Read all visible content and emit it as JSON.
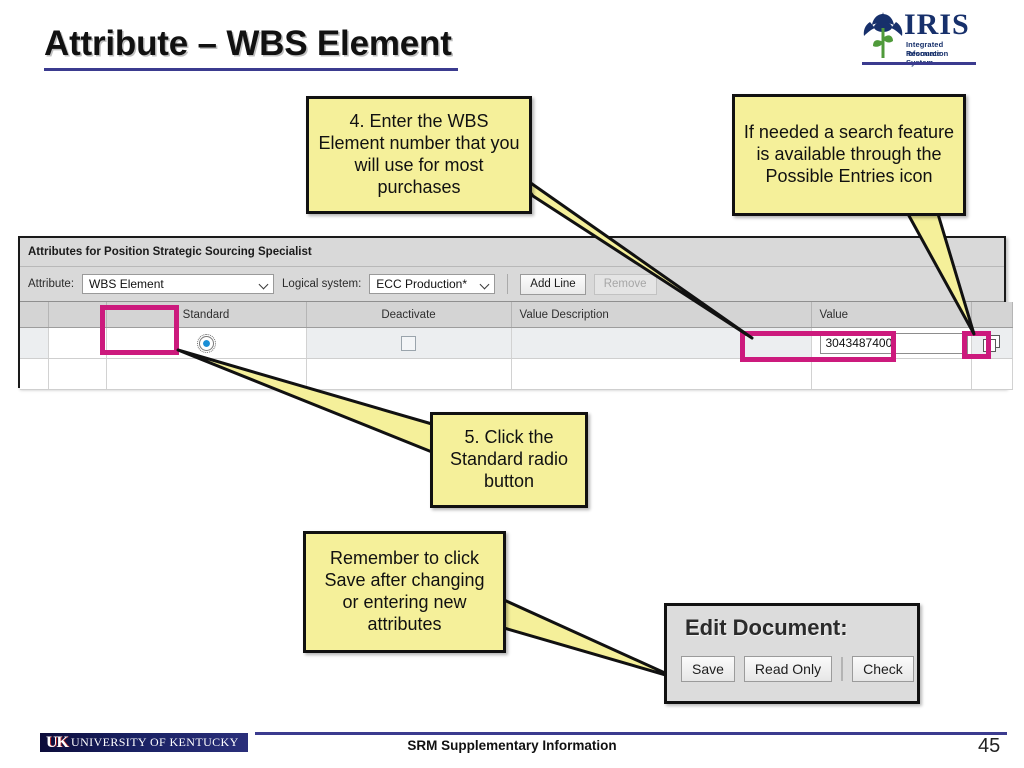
{
  "slide": {
    "title": "Attribute – WBS Element",
    "page_number": "45",
    "footer_text": "SRM Supplementary Information",
    "accent_color": "#3b3b8f",
    "highlight_color": "#cc1a7d",
    "callout_fill": "#f5f09a"
  },
  "iris_logo": {
    "wordmark": "IRIS",
    "subtitle_line1": "Integrated Resource",
    "subtitle_line2": "Information System",
    "icon": "iris-flower-icon"
  },
  "uk_logo": {
    "mark": "UK",
    "wordmark": "UNIVERSITY OF KENTUCKY"
  },
  "sap_panel": {
    "header": "Attributes for Position Strategic Sourcing Specialist",
    "toolbar": {
      "attribute_label": "Attribute:",
      "attribute_value": "WBS Element",
      "logical_system_label": "Logical system:",
      "logical_system_value": "ECC Production*",
      "add_line_label": "Add Line",
      "remove_label": "Remove",
      "remove_disabled": true
    },
    "table": {
      "columns": [
        "",
        "",
        "Standard",
        "Deactivate",
        "Value Description",
        "Value",
        ""
      ],
      "rows": [
        {
          "standard_selected": true,
          "deactivate_checked": false,
          "value_description": "",
          "value": "3043487400",
          "possible_entries_icon": "possible-entries-icon"
        },
        {
          "standard_selected": false,
          "deactivate_checked": false,
          "value_description": "",
          "value": ""
        }
      ]
    }
  },
  "edit_document": {
    "title": "Edit Document:",
    "save_label": "Save",
    "read_only_label": "Read Only",
    "check_label": "Check"
  },
  "callouts": [
    {
      "id": "callout-wbs",
      "text": "4. Enter the WBS Element number that you will use for most purchases"
    },
    {
      "id": "callout-search",
      "text": "If needed a search feature is available through the Possible Entries icon"
    },
    {
      "id": "callout-radio",
      "text": "5. Click the Standard radio button"
    },
    {
      "id": "callout-save",
      "text": "Remember to click Save after changing or entering new attributes"
    }
  ]
}
